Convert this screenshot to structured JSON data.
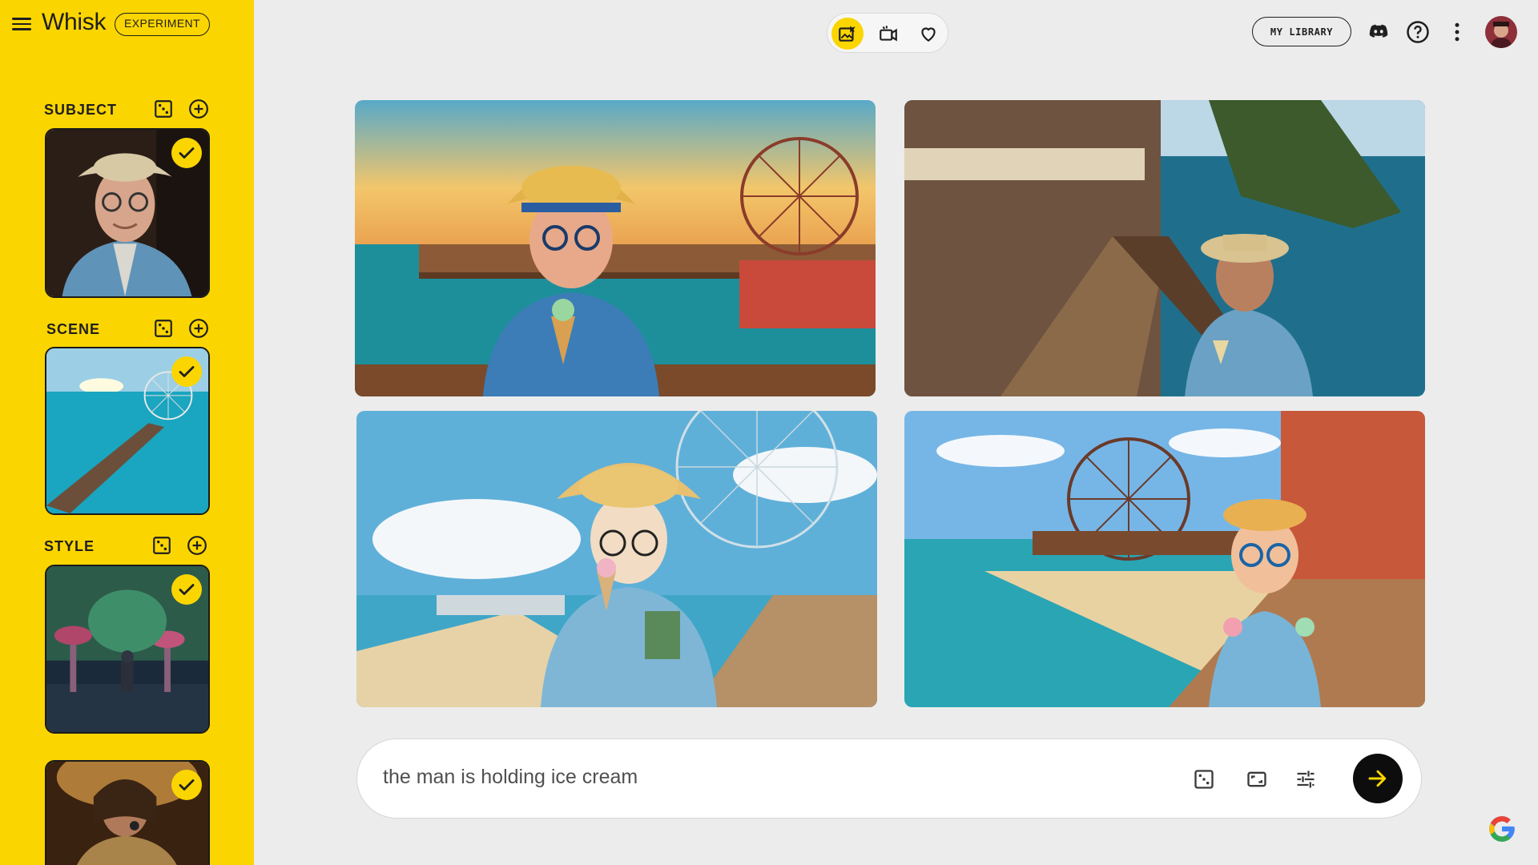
{
  "app": {
    "brand": "Whisk",
    "badge": "EXPERIMENT"
  },
  "sidebar": {
    "sections": [
      {
        "label": "SUBJECT",
        "image": "elderly man with straw hat and glasses, blue jacket",
        "selected": true
      },
      {
        "label": "SCENE",
        "image": "ocean pier with ferris wheel at sunset",
        "selected": true
      },
      {
        "label": "STYLE",
        "image": "pixel art forest with giant mushrooms and knight",
        "selected": true
      },
      {
        "label": "",
        "image": "singer with microphone in sparkling jacket",
        "selected": true
      }
    ],
    "icons": {
      "menu": "menu-icon",
      "random": "dice-icon",
      "add": "add-circle-icon",
      "check": "check-icon"
    }
  },
  "toolbar": {
    "modes": [
      {
        "name": "image-mode",
        "icon": "image-edit-icon",
        "active": true
      },
      {
        "name": "video-mode",
        "icon": "video-icon",
        "active": false
      },
      {
        "name": "favorites-mode",
        "icon": "heart-icon",
        "active": false
      }
    ],
    "library_label": "MY LIBRARY",
    "icons": [
      "discord-icon",
      "help-icon",
      "more-vert-icon"
    ]
  },
  "results": [
    {
      "style": "pixel art pier, man holding ice cream"
    },
    {
      "style": "photoreal boardwalk, man eating ice cream"
    },
    {
      "style": "anime style pier with ferris wheel"
    },
    {
      "style": "3D clay style beach pier"
    }
  ],
  "prompt": {
    "value": "the man is holding ice cream",
    "icons": [
      "dice-icon",
      "aspect-ratio-icon",
      "tune-icon",
      "arrow-forward-icon"
    ]
  },
  "colors": {
    "sidebar_bg": "#fbd500",
    "page_bg": "#ececec",
    "accent": "#fbd500",
    "send_bg": "#0d0d0d"
  }
}
